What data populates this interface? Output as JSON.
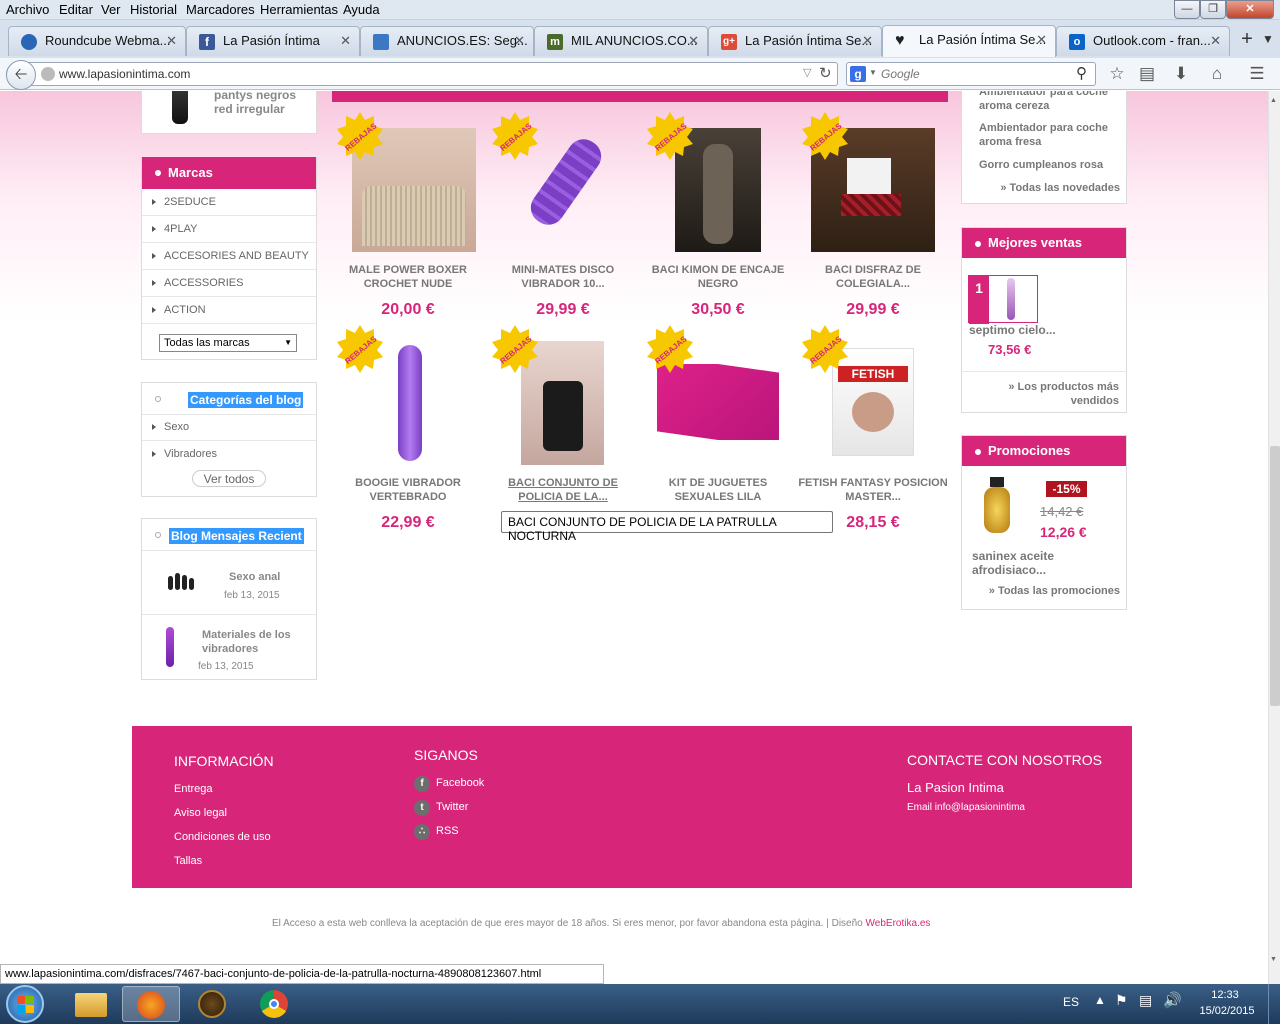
{
  "menubar": {
    "items": [
      "Archivo",
      "Editar",
      "Ver",
      "Historial",
      "Marcadores",
      "Herramientas",
      "Ayuda"
    ]
  },
  "tabs": [
    {
      "label": "Roundcube Webma...",
      "color": "#2b65b5"
    },
    {
      "label": "La Pasión Íntima",
      "color": "#3b5998"
    },
    {
      "label": "ANUNCIOS.ES: Seg...",
      "color": "#3c79c4"
    },
    {
      "label": "MIL ANUNCIOS.CO...",
      "color": "#4b6b2a"
    },
    {
      "label": "La Pasión Íntima Se...",
      "color": "#dd4b39"
    },
    {
      "label": "La Pasión Íntima Se...",
      "color": "#222222"
    },
    {
      "label": "Outlook.com - fran...",
      "color": "#0a64c8"
    }
  ],
  "navbar": {
    "url": "www.lapasionintima.com",
    "search_placeholder": "Google"
  },
  "left": {
    "top_item": "pantys negros red irregular",
    "brands_title": "Marcas",
    "brands": [
      "2SEDUCE",
      "4PLAY",
      "ACCESORIES AND BEAUTY",
      "ACCESSORIES",
      "ACTION"
    ],
    "brands_select": "Todas las marcas",
    "blog_cat_title": "Categorías del blog",
    "blog_cats": [
      "Sexo",
      "Vibradores"
    ],
    "ver_todos": "Ver todos",
    "blog_recent_title": "Blog Mensajes Recient",
    "posts": [
      {
        "title": "Sexo anal",
        "date": "feb 13, 2015"
      },
      {
        "title": "Materiales de los vibradores",
        "date": "feb 13, 2015"
      }
    ]
  },
  "badge_text": "REBAJAS",
  "products": [
    {
      "name": "MALE POWER BOXER CROCHET NUDE",
      "price": "20,00 €"
    },
    {
      "name": "MINI-MATES DISCO VIBRADOR 10...",
      "price": "29,99 €"
    },
    {
      "name": "BACI KIMON DE ENCAJE NEGRO",
      "price": "30,50 €"
    },
    {
      "name": "BACI DISFRAZ DE COLEGIALA...",
      "price": "29,99 €"
    },
    {
      "name": "BOOGIE VIBRADOR VERTEBRADO",
      "price": "22,99 €"
    },
    {
      "name": "BACI CONJUNTO DE POLICIA DE LA...",
      "price": ""
    },
    {
      "name": "KIT DE JUGUETES SEXUALES LILA",
      "price": ""
    },
    {
      "name": "FETISH FANTASY POSICION MASTER...",
      "price": "28,15 €"
    }
  ],
  "tooltip": "BACI CONJUNTO DE POLICIA DE LA PATRULLA NOCTURNA",
  "right": {
    "novedades": [
      "Ambientador para coche aroma cereza",
      "Ambientador para coche aroma fresa",
      "Gorro cumpleanos rosa"
    ],
    "novedades_all": "» Todas las novedades",
    "best_title": "Mejores ventas",
    "best_rank": "1",
    "best_name": "septimo cielo...",
    "best_price": "73,56 €",
    "best_all": "» Los productos más vendidos",
    "promo_title": "Promociones",
    "promo_discount": "-15%",
    "promo_old": "14,42 €",
    "promo_new": "12,26 €",
    "promo_name": "saninex aceite afrodisiaco...",
    "promo_all": "» Todas las promociones"
  },
  "footer": {
    "info_title": "INFORMACIÓN",
    "info_links": [
      "Entrega",
      "Aviso legal",
      "Condiciones de uso",
      "Tallas"
    ],
    "follow_title": "SIGANOS",
    "follow_links": [
      "Facebook",
      "Twitter",
      "RSS"
    ],
    "contact_title": "CONTACTE CON NOSOTROS",
    "contact_name": "La Pasion Intima",
    "contact_email": "Email info@lapasionintima",
    "disclaimer": "El Acceso a esta web conlleva la aceptación de que eres mayor de 18 años. Si eres menor, por favor abandona esta página. | Diseño",
    "design_link": "WebErotika.es"
  },
  "status_url": "www.lapasionintima.com/disfraces/7467-baci-conjunto-de-policia-de-la-patrulla-nocturna-4890808123607.html",
  "taskbar": {
    "lang": "ES",
    "time": "12:33",
    "date": "15/02/2015"
  },
  "colors": {
    "accent": "#d7267a",
    "price": "#d7267a",
    "badge": "#f7c700"
  }
}
